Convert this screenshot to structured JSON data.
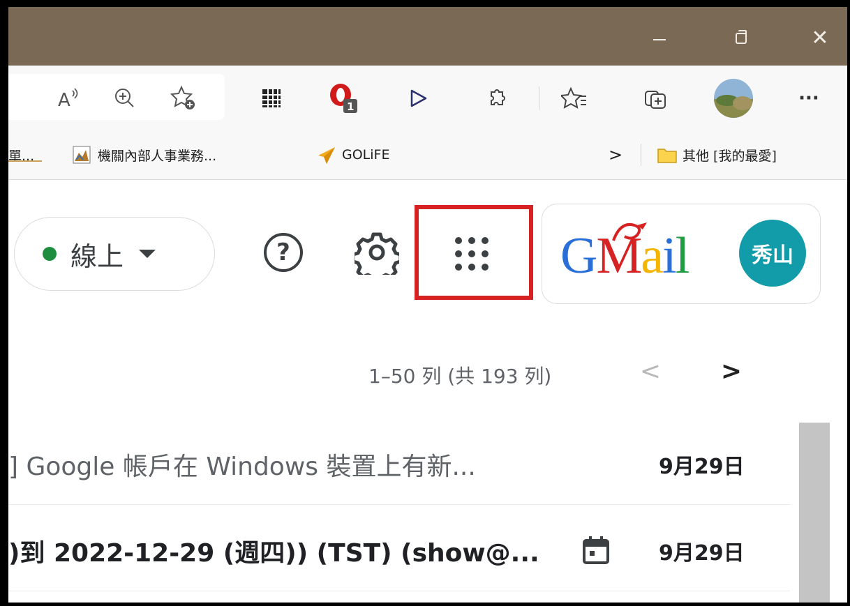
{
  "window": {
    "minimize": "—",
    "maximize": "",
    "close": "✕"
  },
  "toolbar": {
    "read_aloud_icon": "read-aloud-icon",
    "zoom_icon": "zoom-in-icon",
    "add_favorite_icon": "add-favorite-icon",
    "more": "···"
  },
  "bookmarks": {
    "item1": "單...",
    "item2": "機關內部人事業務...",
    "item3": "GOLiFE",
    "overflow": ">",
    "other_folder": "其他 [我的最愛]"
  },
  "header": {
    "status_label": "線上",
    "help_glyph": "?",
    "logo_letters": [
      "G",
      "M",
      "a",
      "i",
      "l"
    ],
    "avatar_text": "秀山",
    "colors": {
      "status_green": "#1e8e3e",
      "highlight_red": "#d62222",
      "avatar_teal": "#129ba8",
      "titlebar": "#7a6a55"
    }
  },
  "pagination": {
    "count": "1–50 列 (共 193 列)",
    "prev": "<",
    "next": ">"
  },
  "emails": [
    {
      "subject": "] Google 帳戶在 Windows 裝置上有新...",
      "date": "9月29日",
      "unread": false,
      "has_calendar": false
    },
    {
      "subject": ")到 2022-12-29 (週四)) (TST) (show@...",
      "date": "9月29日",
      "unread": true,
      "has_calendar": true
    }
  ]
}
